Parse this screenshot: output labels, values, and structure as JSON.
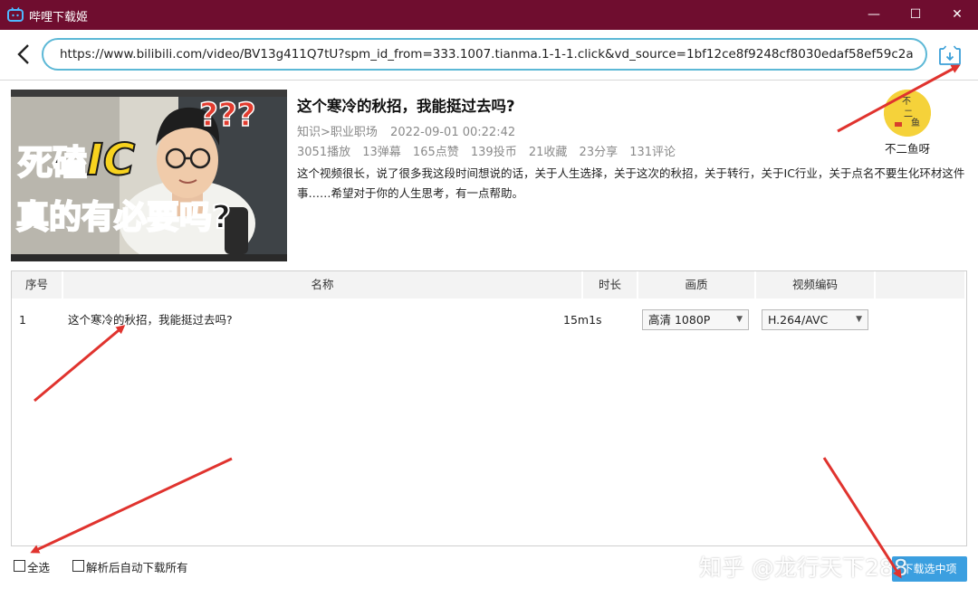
{
  "window": {
    "title": "哔哩下载姬",
    "controls": [
      "—",
      "☐",
      "✕"
    ],
    "titlebar_color": "#6f0d2f"
  },
  "url_bar": {
    "value": "https://www.bilibili.com/video/BV13g411Q7tU?spm_id_from=333.1007.tianma.1-1-1.click&vd_source=1bf12ce8f9248cf8030edaf58ef59c2a",
    "back_icon": "chevron-left-icon",
    "download_icon": "download-box-icon",
    "accent": "#5cb8d6"
  },
  "thumbnail": {
    "line1_a": "死磕",
    "line1_b": "IC",
    "line2": "真的有必要吗?",
    "question_marks": "???"
  },
  "video": {
    "title": "这个寒冷的秋招，我能挺过去吗?",
    "category": "知识>职业职场",
    "date": "2022-09-01 00:22:42",
    "stats": [
      "3051播放",
      "13弹幕",
      "165点赞",
      "139投币",
      "21收藏",
      "23分享",
      "131评论"
    ],
    "description": "这个视频很长，说了很多我这段时间想说的话，关于人生选择，关于这次的秋招，关于转行，关于IC行业，关于点名不要生化环材这件事……希望对于你的人生思考，有一点帮助。"
  },
  "uploader": {
    "name": "不二鱼呀",
    "avatar_color": "#f5d23a"
  },
  "table": {
    "columns": [
      "序号",
      "名称",
      "时长",
      "画质",
      "视频编码"
    ],
    "rows": [
      {
        "index": "1",
        "name": "这个寒冷的秋招，我能挺过去吗?",
        "duration": "15m1s",
        "quality": "高清 1080P",
        "codec": "H.264/AVC"
      }
    ]
  },
  "footer": {
    "select_all": "全选",
    "auto_download": "解析后自动下载所有",
    "download_button": "下载选中项",
    "button_color": "#3b9fe0"
  },
  "watermark": "知乎 @龙行天下288",
  "annotation_arrow_color": "#e0332e"
}
